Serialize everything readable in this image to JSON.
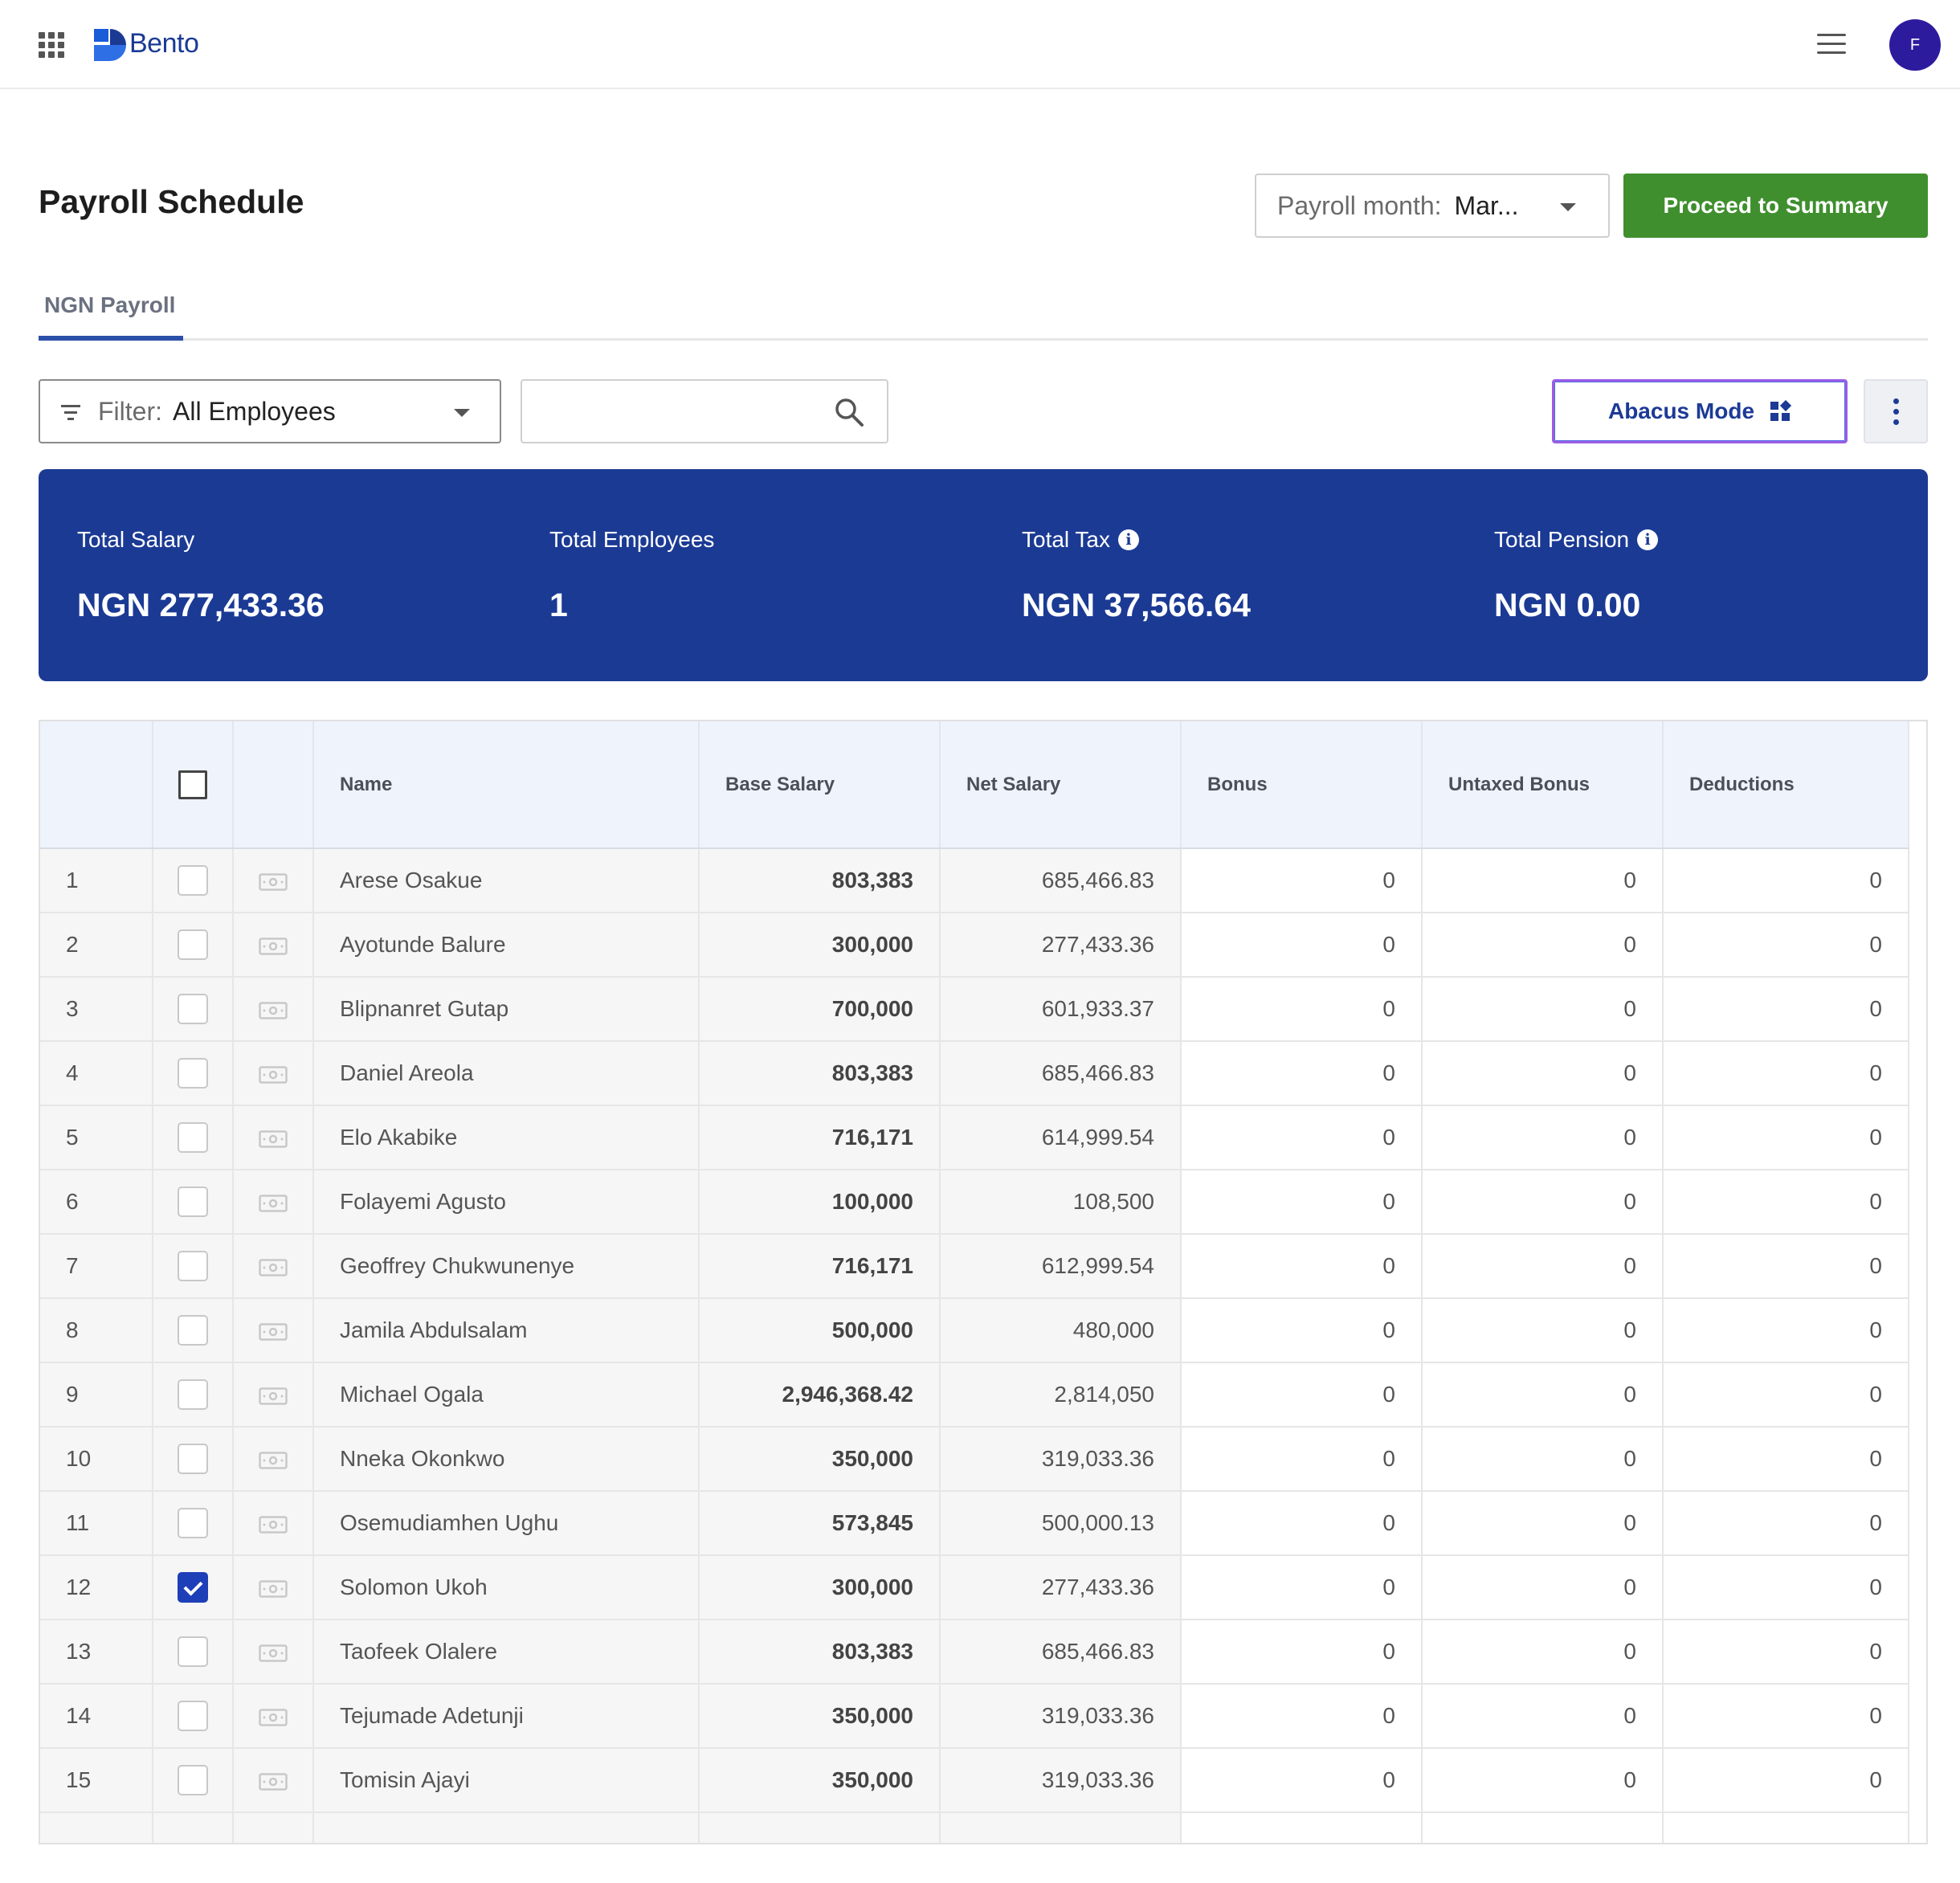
{
  "app": {
    "name": "Bento",
    "avatar_initial": "F",
    "brand_color": "#1a3a94"
  },
  "header": {
    "title": "Payroll Schedule",
    "month_label": "Payroll month:",
    "month_value": "Mar...",
    "proceed_label": "Proceed to Summary"
  },
  "tabs": [
    {
      "label": "NGN Payroll",
      "active": true
    }
  ],
  "toolbar": {
    "filter_label": "Filter:",
    "filter_value": "All Employees",
    "search_placeholder": "",
    "abacus_label": "Abacus Mode"
  },
  "summary": {
    "total_salary_label": "Total Salary",
    "total_salary_value": "NGN 277,433.36",
    "total_employees_label": "Total Employees",
    "total_employees_value": "1",
    "total_tax_label": "Total Tax",
    "total_tax_value": "NGN 37,566.64",
    "total_pension_label": "Total Pension",
    "total_pension_value": "NGN 0.00"
  },
  "table": {
    "columns": [
      "Name",
      "Base Salary",
      "Net Salary",
      "Bonus",
      "Untaxed Bonus",
      "Deductions"
    ],
    "rows": [
      {
        "idx": "1",
        "checked": false,
        "name": "Arese Osakue",
        "base": "803,383",
        "net": "685,466.83",
        "bonus": "0",
        "untaxed": "0",
        "deductions": "0"
      },
      {
        "idx": "2",
        "checked": false,
        "name": "Ayotunde Balure",
        "base": "300,000",
        "net": "277,433.36",
        "bonus": "0",
        "untaxed": "0",
        "deductions": "0"
      },
      {
        "idx": "3",
        "checked": false,
        "name": "Blipnanret Gutap",
        "base": "700,000",
        "net": "601,933.37",
        "bonus": "0",
        "untaxed": "0",
        "deductions": "0"
      },
      {
        "idx": "4",
        "checked": false,
        "name": "Daniel Areola",
        "base": "803,383",
        "net": "685,466.83",
        "bonus": "0",
        "untaxed": "0",
        "deductions": "0"
      },
      {
        "idx": "5",
        "checked": false,
        "name": "Elo Akabike",
        "base": "716,171",
        "net": "614,999.54",
        "bonus": "0",
        "untaxed": "0",
        "deductions": "0"
      },
      {
        "idx": "6",
        "checked": false,
        "name": "Folayemi Agusto",
        "base": "100,000",
        "net": "108,500",
        "bonus": "0",
        "untaxed": "0",
        "deductions": "0"
      },
      {
        "idx": "7",
        "checked": false,
        "name": "Geoffrey Chukwunenye",
        "base": "716,171",
        "net": "612,999.54",
        "bonus": "0",
        "untaxed": "0",
        "deductions": "0"
      },
      {
        "idx": "8",
        "checked": false,
        "name": "Jamila Abdulsalam",
        "base": "500,000",
        "net": "480,000",
        "bonus": "0",
        "untaxed": "0",
        "deductions": "0"
      },
      {
        "idx": "9",
        "checked": false,
        "name": "Michael Ogala",
        "base": "2,946,368.42",
        "net": "2,814,050",
        "bonus": "0",
        "untaxed": "0",
        "deductions": "0"
      },
      {
        "idx": "10",
        "checked": false,
        "name": "Nneka Okonkwo",
        "base": "350,000",
        "net": "319,033.36",
        "bonus": "0",
        "untaxed": "0",
        "deductions": "0"
      },
      {
        "idx": "11",
        "checked": false,
        "name": "Osemudiamhen Ughu",
        "base": "573,845",
        "net": "500,000.13",
        "bonus": "0",
        "untaxed": "0",
        "deductions": "0"
      },
      {
        "idx": "12",
        "checked": true,
        "name": "Solomon Ukoh",
        "base": "300,000",
        "net": "277,433.36",
        "bonus": "0",
        "untaxed": "0",
        "deductions": "0"
      },
      {
        "idx": "13",
        "checked": false,
        "name": "Taofeek Olalere",
        "base": "803,383",
        "net": "685,466.83",
        "bonus": "0",
        "untaxed": "0",
        "deductions": "0"
      },
      {
        "idx": "14",
        "checked": false,
        "name": "Tejumade Adetunji",
        "base": "350,000",
        "net": "319,033.36",
        "bonus": "0",
        "untaxed": "0",
        "deductions": "0"
      },
      {
        "idx": "15",
        "checked": false,
        "name": "Tomisin Ajayi",
        "base": "350,000",
        "net": "319,033.36",
        "bonus": "0",
        "untaxed": "0",
        "deductions": "0"
      }
    ]
  },
  "colors": {
    "primary": "#1b3a94",
    "success": "#3f8f2e",
    "accent_border": "#9b5de5"
  }
}
